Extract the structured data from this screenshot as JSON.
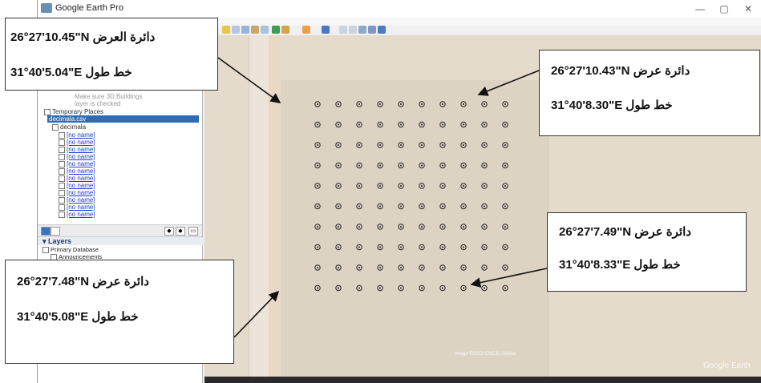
{
  "window": {
    "title": "Google Earth Pro",
    "minimize": "—",
    "maximize": "▢",
    "close": "✕"
  },
  "sidebar": {
    "hint_line1": "Make sure 3D Buildings",
    "hint_line2": "layer is checked",
    "temporary_places": "Temporary Places",
    "selected_file": "decimala.csv",
    "folder": "decimala",
    "placemark_label": "[no name]",
    "layers_title": "Layers",
    "primary_database": "Primary Database",
    "announcements": "Announcements"
  },
  "map": {
    "imagery_credit": "Image ©2023 CNES / Airbus",
    "watermark": "Google Earth"
  },
  "callouts": [
    {
      "id": "top-left",
      "lat": "26°27'10.45\"N دائرة العرض",
      "lon": "31°40'5.04\"E  خط طول"
    },
    {
      "id": "top-right",
      "lat": "26°27'10.43\"N  دائرة عرض",
      "lon": "31°40'8.30\"E  خط طول"
    },
    {
      "id": "bottom-right",
      "lat": "26°27'7.49\"N  دائرة عرض",
      "lon": "31°40'8.33\"E  خط طول"
    },
    {
      "id": "bottom-left",
      "lat": "26°27'7.48\"N دائرة عرض",
      "lon": "31°40'5.08\"E خط طول"
    }
  ],
  "colors": {
    "selection": "#2e6db5",
    "placemark": "#222222",
    "terrain": "#e4dbcc"
  },
  "icons": [
    "app-icon",
    "placemark-target-icon",
    "folder-icon",
    "checkbox-icon",
    "arrow-icon"
  ]
}
